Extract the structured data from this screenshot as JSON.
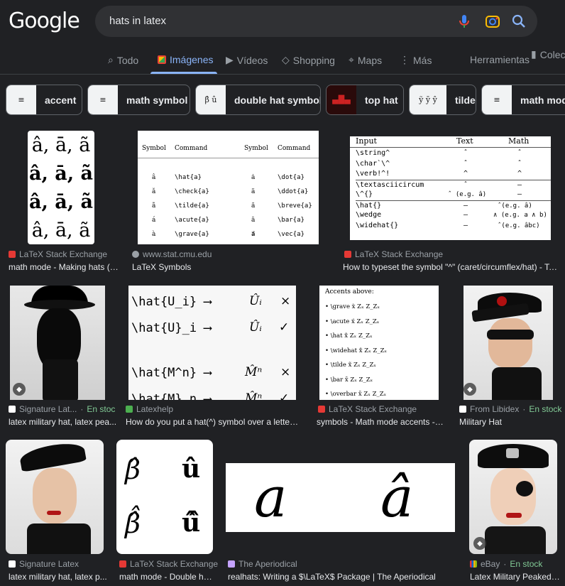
{
  "logo": "Google",
  "search": {
    "query": "hats in latex"
  },
  "tabs": [
    {
      "label": "Todo"
    },
    {
      "label": "Imágenes"
    },
    {
      "label": "Vídeos"
    },
    {
      "label": "Shopping"
    },
    {
      "label": "Maps"
    },
    {
      "label": "Más"
    }
  ],
  "tools": {
    "herramientas": "Herramientas",
    "coleccion": "Colec"
  },
  "chips": [
    {
      "label": "accent"
    },
    {
      "label": "math symbol"
    },
    {
      "label": "double hat symbol"
    },
    {
      "label": "top hat"
    },
    {
      "label": "tilde"
    },
    {
      "label": "math mode"
    }
  ],
  "results": [
    {
      "source": "LaTeX Stack Exchange",
      "title": "math mode - Making hats (a..."
    },
    {
      "source": "www.stat.cmu.edu",
      "title": "LaTeX Symbols"
    },
    {
      "source": "LaTeX Stack Exchange",
      "title": "How to typeset the symbol \"^\" (caret/circumflex/hat) - TeX -..."
    },
    {
      "source": "Signature Lat...",
      "stock": "En stock",
      "title": "latex military hat, latex pea..."
    },
    {
      "source": "Latexhelp",
      "title": "How do you put a hat(^) symbol over a letter in ..."
    },
    {
      "source": "LaTeX Stack Exchange",
      "title": "symbols - Math mode accents - T..."
    },
    {
      "source": "From Libidex",
      "stock": "En stock",
      "title": "Military Hat"
    },
    {
      "source": "Signature Latex",
      "title": "latex military hat, latex p..."
    },
    {
      "source": "LaTeX Stack Exchange",
      "title": "math mode - Double hat..."
    },
    {
      "source": "The Aperiodical",
      "title": "realhats: Writing a $\\LaTeX$ Package | The Aperiodical"
    },
    {
      "source": "eBay",
      "stock": "En stock",
      "title": "Latex Military Peaked c..."
    }
  ],
  "img1": {
    "rows": [
      "â, ā, ã",
      "â, ā, ã",
      "â, ā, ã",
      "â, ā, ã"
    ]
  },
  "img2": {
    "headers": [
      "Symbol",
      "Command",
      "Symbol",
      "Command"
    ],
    "rows": [
      [
        "â",
        "\\hat{a}",
        "ȧ",
        "\\dot{a}"
      ],
      [
        "ǎ",
        "\\check{a}",
        "ä",
        "\\ddot{a}"
      ],
      [
        "ã",
        "\\tilde{a}",
        "ă",
        "\\breve{a}"
      ],
      [
        "á",
        "\\acute{a}",
        "ā",
        "\\bar{a}"
      ],
      [
        "à",
        "\\grave{a}",
        "a⃗",
        "\\vec{a}"
      ]
    ]
  },
  "img3": {
    "headers": [
      "Input",
      "Text",
      "Math"
    ],
    "rows": [
      [
        "\\string^",
        "ˆ",
        "ˆ"
      ],
      [
        "\\char`\\^",
        "ˆ",
        "ˆ"
      ],
      [
        "\\verb!^!",
        "^",
        "^"
      ],
      [
        "\\textasciicircum",
        "ˆ",
        "—"
      ],
      [
        "\\^{}",
        "ˆ (e.g. â)",
        "—"
      ],
      [
        "\\hat{}",
        "—",
        "ˆ(e.g. â)"
      ],
      [
        "\\wedge",
        "—",
        "∧ (e.g. a ∧ b)"
      ],
      [
        "\\widehat{}",
        "—",
        "ˆ(e.g. âbc)"
      ]
    ]
  },
  "img5": {
    "rows": [
      [
        "\\hat{U_i} ⟶",
        "Ûᵢ",
        "×"
      ],
      [
        "\\hat{U}_i ⟶",
        "Ûᵢ",
        "✓"
      ],
      [
        "\\hat{M^n} ⟶",
        "M̂ⁿ",
        "×"
      ],
      [
        "\\hat{M}_n ⟶",
        "M̂ⁿ",
        "✓"
      ]
    ]
  },
  "img6": {
    "heading": "Accents above:",
    "rows": [
      "• \\grave x̀  Zₓ  Z_Zₓ",
      "• \\acute x́  Zₓ  Z_Zₓ",
      "• \\hat x̂  Zₓ  Z_Zₓ",
      "• \\widehat x̂  Zₓ  Z_Zₓ",
      "• \\tilde x̃  Zₓ  Z_Zₓ",
      "• \\bar x̄  Zₓ  Z_Zₓ",
      "• \\overbar x̄  Zₓ  Z_Zₓ"
    ]
  },
  "img9": {
    "glyphs": [
      "β̂",
      "û",
      "β̂̂",
      "û̂"
    ]
  },
  "img10": {
    "glyphs": [
      "a",
      "â"
    ]
  },
  "colors": {
    "accent": "#8ab4f8",
    "bg": "#202124",
    "stock": "#81c995"
  }
}
